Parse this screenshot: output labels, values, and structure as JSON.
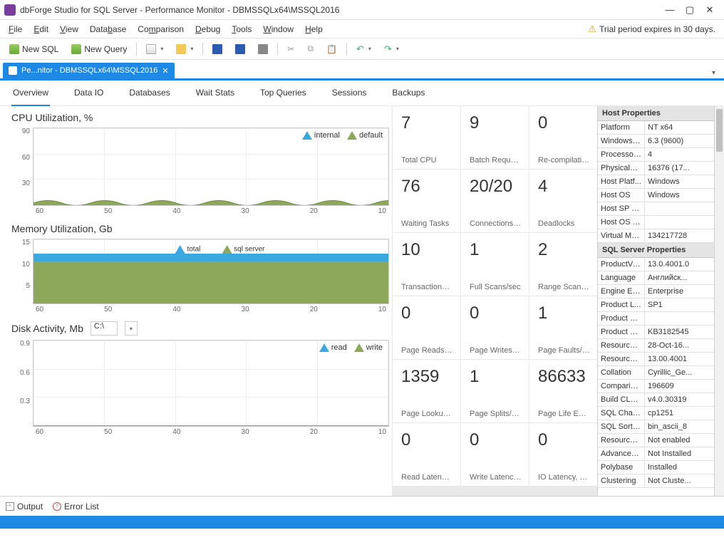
{
  "window": {
    "title": "dbForge Studio for SQL Server - Performance Monitor - DBMSSQLx64\\MSSQL2016"
  },
  "menus": [
    "File",
    "Edit",
    "View",
    "Database",
    "Comparison",
    "Debug",
    "Tools",
    "Window",
    "Help"
  ],
  "trial_msg": "Trial period expires in 30 days.",
  "toolbar": {
    "new_sql": "New SQL",
    "new_query": "New Query"
  },
  "doctab": {
    "label": "Pe...nitor - DBMSSQLx64\\MSSQL2016"
  },
  "navtabs": [
    "Overview",
    "Data IO",
    "Databases",
    "Wait Stats",
    "Top Queries",
    "Sessions",
    "Backups"
  ],
  "charts": {
    "cpu": {
      "title": "CPU Utilization, %",
      "legend": [
        "internal",
        "default"
      ]
    },
    "mem": {
      "title": "Memory Utilization, Gb",
      "legend": [
        "total",
        "sql server"
      ]
    },
    "disk": {
      "title": "Disk Activity, Mb",
      "drive": "C:\\",
      "legend": [
        "read",
        "write"
      ]
    }
  },
  "chart_data": [
    {
      "type": "area",
      "title": "CPU Utilization, %",
      "x": [
        60,
        50,
        40,
        30,
        20,
        10
      ],
      "series": [
        {
          "name": "internal",
          "values": [
            3,
            3,
            3,
            3,
            3,
            3
          ]
        },
        {
          "name": "default",
          "values": [
            5,
            5,
            5,
            5,
            5,
            5
          ]
        }
      ],
      "yticks": [
        30,
        60,
        90
      ],
      "xticks": [
        60,
        50,
        40,
        30,
        20,
        10
      ],
      "ylim": [
        0,
        100
      ],
      "xlabel": "",
      "ylabel": ""
    },
    {
      "type": "area",
      "title": "Memory Utilization, Gb",
      "x": [
        60,
        50,
        40,
        30,
        20,
        10
      ],
      "series": [
        {
          "name": "total",
          "values": [
            12,
            12,
            12,
            12,
            12,
            12
          ]
        },
        {
          "name": "sql server",
          "values": [
            10,
            10,
            10,
            10,
            10,
            10
          ]
        }
      ],
      "yticks": [
        5,
        10,
        15
      ],
      "xticks": [
        60,
        50,
        40,
        30,
        20,
        10
      ],
      "ylim": [
        0,
        16
      ],
      "xlabel": "",
      "ylabel": ""
    },
    {
      "type": "line",
      "title": "Disk Activity, Mb",
      "x": [
        60,
        50,
        40,
        30,
        20,
        10
      ],
      "series": [
        {
          "name": "read",
          "values": [
            0,
            0,
            0,
            0,
            0,
            0
          ]
        },
        {
          "name": "write",
          "values": [
            0,
            0,
            0,
            0,
            0,
            0
          ]
        }
      ],
      "yticks": [
        0.3,
        0.6,
        0.9
      ],
      "xticks": [
        60,
        50,
        40,
        30,
        20,
        10
      ],
      "ylim": [
        0,
        1
      ],
      "xlabel": "",
      "ylabel": ""
    }
  ],
  "stats": [
    {
      "value": "7",
      "label": "Total CPU"
    },
    {
      "value": "9",
      "label": "Batch Requests/s"
    },
    {
      "value": "0",
      "label": "Re-compilations/s"
    },
    {
      "value": "76",
      "label": "Waiting Tasks"
    },
    {
      "value": "20/20",
      "label": "Connections (user"
    },
    {
      "value": "4",
      "label": "Deadlocks"
    },
    {
      "value": "10",
      "label": "Transactions/sec"
    },
    {
      "value": "1",
      "label": "Full Scans/sec"
    },
    {
      "value": "2",
      "label": "Range Scans/sec"
    },
    {
      "value": "0",
      "label": "Page Reads/sec"
    },
    {
      "value": "0",
      "label": "Page Writes/sec"
    },
    {
      "value": "1",
      "label": "Page Faults/sec"
    },
    {
      "value": "1359",
      "label": "Page Lookups/sec"
    },
    {
      "value": "1",
      "label": "Page Splits/sec"
    },
    {
      "value": "86633",
      "label": "Page Life Expecta"
    },
    {
      "value": "0",
      "label": "Read Latency, ms"
    },
    {
      "value": "0",
      "label": "Write Latency, ms"
    },
    {
      "value": "0",
      "label": "IO Latency, ms"
    }
  ],
  "host_props_header": "Host Properties",
  "host_props": [
    {
      "k": "Platform",
      "v": "NT x64"
    },
    {
      "k": "WindowsV...",
      "v": "6.3 (9600)"
    },
    {
      "k": "Processor...",
      "v": "4"
    },
    {
      "k": "PhysicalM...",
      "v": "16376 (17..."
    },
    {
      "k": "Host Platf...",
      "v": "Windows"
    },
    {
      "k": "Host OS",
      "v": "Windows"
    },
    {
      "k": "Host SP L...",
      "v": ""
    },
    {
      "k": "Host OS L...",
      "v": ""
    },
    {
      "k": "Virtual Me...",
      "v": "134217728"
    }
  ],
  "sql_props_header": "SQL Server Properties",
  "sql_props": [
    {
      "k": "ProductVe...",
      "v": "13.0.4001.0"
    },
    {
      "k": "Language",
      "v": "Английск..."
    },
    {
      "k": "Engine Edi...",
      "v": "Enterprise"
    },
    {
      "k": "Product L...",
      "v": "SP1"
    },
    {
      "k": "Product U...",
      "v": ""
    },
    {
      "k": "Product U...",
      "v": "KB3182545"
    },
    {
      "k": "Resource ...",
      "v": "28-Oct-16..."
    },
    {
      "k": "Resource ...",
      "v": "13.00.4001"
    },
    {
      "k": "Collation",
      "v": "Cyrillic_Ge..."
    },
    {
      "k": "Compariso...",
      "v": "196609"
    },
    {
      "k": "Build CLR ...",
      "v": "v4.0.30319"
    },
    {
      "k": "SQL Charset",
      "v": "cp1251"
    },
    {
      "k": "SQL Sort ...",
      "v": "bin_ascii_8"
    },
    {
      "k": "Resource ...",
      "v": "Not enabled"
    },
    {
      "k": "Advanced...",
      "v": "Not Installed"
    },
    {
      "k": "Polybase",
      "v": "Installed"
    },
    {
      "k": "Clustering",
      "v": "Not Cluste..."
    }
  ],
  "bottom": {
    "output": "Output",
    "errors": "Error List"
  }
}
